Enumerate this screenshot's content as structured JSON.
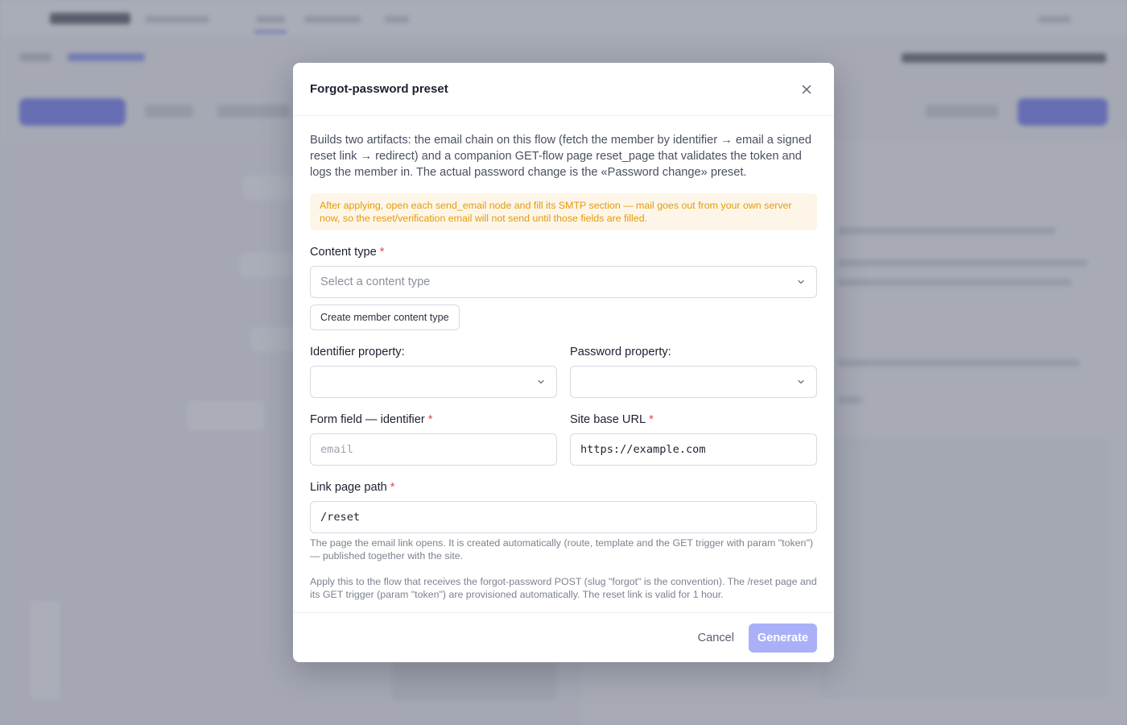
{
  "modal": {
    "title": "Forgot-password preset",
    "description": "Builds two artifacts: the email chain on this flow (fetch the member by identifier → email a signed reset link → redirect) and a companion GET-flow page reset_page that validates the token and logs the member in. The actual password change is the «Password change» preset.",
    "warning": "After applying, open each send_email node and fill its SMTP section — mail goes out from your own server now, so the reset/verification email will not send until those fields are filled.",
    "content_type": {
      "label": "Content type",
      "required_mark": "*",
      "placeholder": "Select a content type",
      "create_button": "Create member content type"
    },
    "identifier_property": {
      "label": "Identifier property:",
      "value": ""
    },
    "password_property": {
      "label": "Password property:",
      "value": ""
    },
    "form_field_identifier": {
      "label": "Form field — identifier",
      "required_mark": "*",
      "placeholder": "email",
      "value": ""
    },
    "site_base_url": {
      "label": "Site base URL",
      "required_mark": "*",
      "value": "https://example.com"
    },
    "link_page_path": {
      "label": "Link page path",
      "required_mark": "*",
      "value": "/reset",
      "hint": "The page the email link opens. It is created automatically (route, template and the GET trigger with param \"token\") — published together with the site."
    },
    "footer_note": "Apply this to the flow that receives the forgot-password POST (slug \"forgot\" is the convention). The /reset page and its GET trigger (param \"token\") are provisioned automatically. The reset link is valid for 1 hour.",
    "cancel_label": "Cancel",
    "generate_label": "Generate",
    "generate_enabled": false
  },
  "colors": {
    "accent": "#4b54ef",
    "accent_disabled": "#aab0f8",
    "warning_text": "#e59a09",
    "warning_bg": "#fdf6e8",
    "required": "#e5484d"
  },
  "icons": [
    "close-icon",
    "chevron-down-icon"
  ]
}
